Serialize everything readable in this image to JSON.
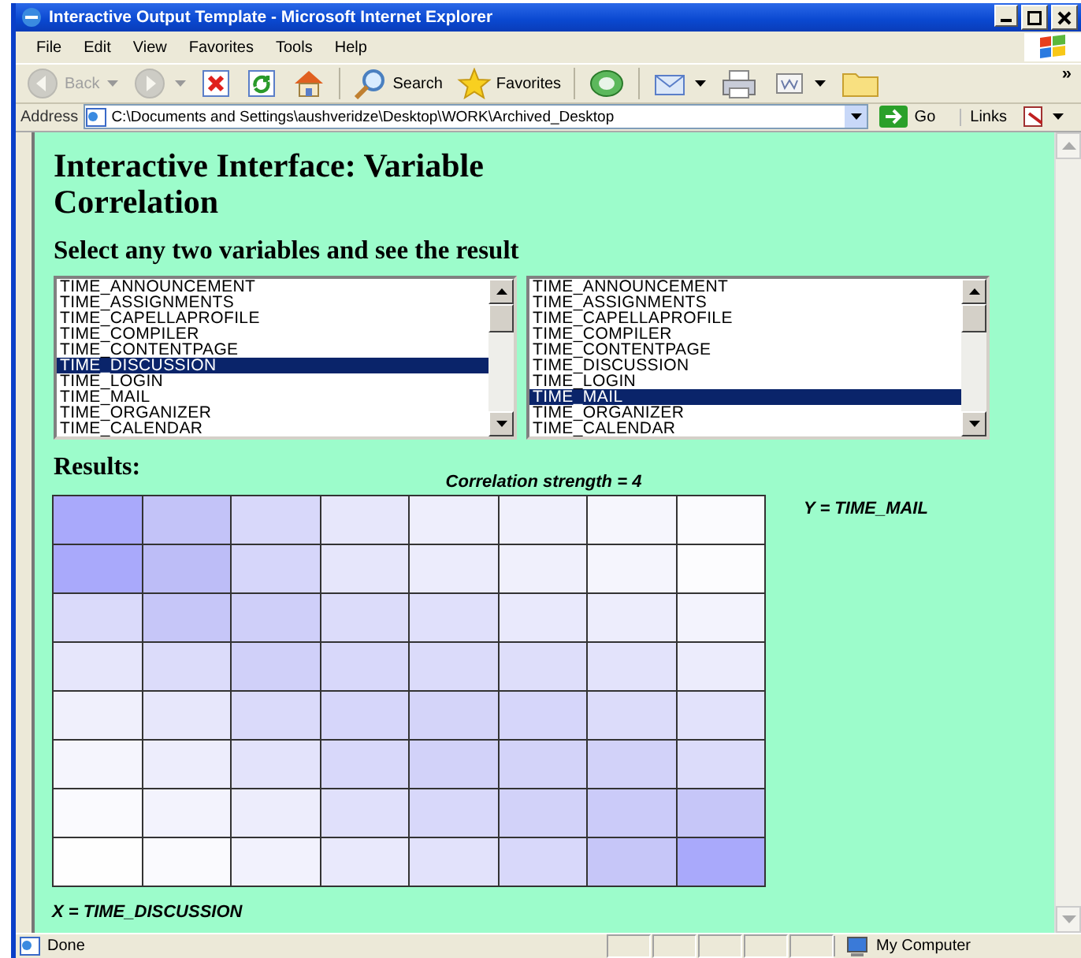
{
  "window": {
    "title": "Interactive Output Template - Microsoft Internet Explorer"
  },
  "menu": [
    "File",
    "Edit",
    "View",
    "Favorites",
    "Tools",
    "Help"
  ],
  "toolbar": [
    {
      "kind": "back",
      "label": "Back",
      "disabled": true,
      "menu": true
    },
    {
      "kind": "forward",
      "disabled": true,
      "menu": true
    },
    {
      "kind": "stop",
      "disabled": false,
      "menu": false
    },
    {
      "kind": "refresh",
      "disabled": false,
      "menu": false
    },
    {
      "kind": "home",
      "disabled": false,
      "menu": false
    },
    {
      "kind": "search",
      "label": "Search",
      "disabled": false,
      "menu": false
    },
    {
      "kind": "favorites",
      "label": "Favorites",
      "disabled": false,
      "menu": false
    },
    {
      "kind": "media",
      "disabled": false,
      "menu": false
    },
    {
      "kind": "mail",
      "disabled": false,
      "menu": true
    },
    {
      "kind": "print",
      "disabled": false,
      "menu": false
    },
    {
      "kind": "edit",
      "disabled": false,
      "menu": true
    },
    {
      "kind": "folder",
      "disabled": false,
      "menu": false
    }
  ],
  "toolbar_more": "»",
  "address": {
    "label": "Address",
    "value": "C:\\Documents and Settings\\aushveridze\\Desktop\\WORK\\Archived_Desktop",
    "go": "Go",
    "links": "Links"
  },
  "page": {
    "title": "Interactive Interface: Variable Correlation",
    "subtitle": "Select any two variables and see the result",
    "lists": [
      {
        "items": [
          {
            "label": "TIME_ANNOUNCEMENT",
            "selected": false
          },
          {
            "label": "TIME_ASSIGNMENTS",
            "selected": false
          },
          {
            "label": "TIME_CAPELLAPROFILE",
            "selected": false
          },
          {
            "label": "TIME_COMPILER",
            "selected": false
          },
          {
            "label": "TIME_CONTENTPAGE",
            "selected": false
          },
          {
            "label": "TIME_DISCUSSION",
            "selected": true
          },
          {
            "label": "TIME_LOGIN",
            "selected": false
          },
          {
            "label": "TIME_MAIL",
            "selected": false
          },
          {
            "label": "TIME_ORGANIZER",
            "selected": false
          },
          {
            "label": "TIME_CALENDAR",
            "selected": false
          }
        ]
      },
      {
        "items": [
          {
            "label": "TIME_ANNOUNCEMENT",
            "selected": false
          },
          {
            "label": "TIME_ASSIGNMENTS",
            "selected": false
          },
          {
            "label": "TIME_CAPELLAPROFILE",
            "selected": false
          },
          {
            "label": "TIME_COMPILER",
            "selected": false
          },
          {
            "label": "TIME_CONTENTPAGE",
            "selected": false
          },
          {
            "label": "TIME_DISCUSSION",
            "selected": false
          },
          {
            "label": "TIME_LOGIN",
            "selected": false
          },
          {
            "label": "TIME_MAIL",
            "selected": true
          },
          {
            "label": "TIME_ORGANIZER",
            "selected": false
          },
          {
            "label": "TIME_CALENDAR",
            "selected": false
          }
        ]
      }
    ],
    "results_heading": "Results:",
    "caption": "Correlation strength = 4",
    "y_label": "Y = TIME_MAIL",
    "x_label": "X = TIME_DISCUSSION",
    "heatmap": [
      [
        {
          "color": "#a9a9fb"
        },
        {
          "color": "#c3c3f8"
        },
        {
          "color": "#d8d8fa"
        },
        {
          "color": "#e7e7fb"
        },
        {
          "color": "#eeeefc"
        },
        {
          "color": "#f0f0fc"
        },
        {
          "color": "#f6f6fd"
        },
        {
          "color": "#fbfbfe"
        }
      ],
      [
        {
          "color": "#a9a9fb"
        },
        {
          "color": "#bdbdf7"
        },
        {
          "color": "#d6d6fa"
        },
        {
          "color": "#e6e6fb"
        },
        {
          "color": "#ececfc"
        },
        {
          "color": "#f0f0fc"
        },
        {
          "color": "#f5f5fd"
        },
        {
          "color": "#fcfcfe"
        }
      ],
      [
        {
          "color": "#dadafa"
        },
        {
          "color": "#c6c6f8"
        },
        {
          "color": "#cfcff9"
        },
        {
          "color": "#dcdcfa"
        },
        {
          "color": "#e0e0fb"
        },
        {
          "color": "#e9e9fc"
        },
        {
          "color": "#ededfc"
        },
        {
          "color": "#f3f3fd"
        }
      ],
      [
        {
          "color": "#e6e6fb"
        },
        {
          "color": "#dcdcfa"
        },
        {
          "color": "#d0d0f9"
        },
        {
          "color": "#d8d8fa"
        },
        {
          "color": "#dbdbfa"
        },
        {
          "color": "#dedefa"
        },
        {
          "color": "#e3e3fb"
        },
        {
          "color": "#ececfc"
        }
      ],
      [
        {
          "color": "#f0f0fc"
        },
        {
          "color": "#e7e7fb"
        },
        {
          "color": "#dadafa"
        },
        {
          "color": "#d6d6fa"
        },
        {
          "color": "#d4d4f9"
        },
        {
          "color": "#d6d6fa"
        },
        {
          "color": "#dcdcfa"
        },
        {
          "color": "#e2e2fb"
        }
      ],
      [
        {
          "color": "#f5f5fd"
        },
        {
          "color": "#ededfc"
        },
        {
          "color": "#e3e3fb"
        },
        {
          "color": "#d8d8fa"
        },
        {
          "color": "#d2d2f9"
        },
        {
          "color": "#d3d3f9"
        },
        {
          "color": "#d2d2f9"
        },
        {
          "color": "#dcdcfa"
        }
      ],
      [
        {
          "color": "#fafafe"
        },
        {
          "color": "#f3f3fd"
        },
        {
          "color": "#ededfc"
        },
        {
          "color": "#e0e0fb"
        },
        {
          "color": "#d8d8fa"
        },
        {
          "color": "#d2d2f9"
        },
        {
          "color": "#cbcbf9"
        },
        {
          "color": "#c6c6f8"
        }
      ],
      [
        {
          "color": "#fefefe"
        },
        {
          "color": "#fafafe"
        },
        {
          "color": "#f2f2fd"
        },
        {
          "color": "#e9e9fc"
        },
        {
          "color": "#e2e2fb"
        },
        {
          "color": "#d8d8fa"
        },
        {
          "color": "#c6c6f8"
        },
        {
          "color": "#a9a9fb"
        }
      ]
    ]
  },
  "status_bar": {
    "text": "Done",
    "zone": "My Computer"
  }
}
